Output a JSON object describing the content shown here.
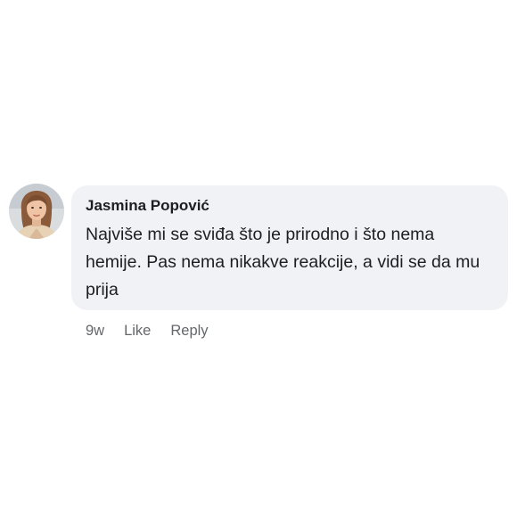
{
  "comment": {
    "author": "Jasmina Popović",
    "text": "Najviše mi se sviđa što je prirodno i što nema hemije. Pas nema nikakve reakcije, a vidi se da mu prija",
    "timestamp": "9w",
    "like_label": "Like",
    "reply_label": "Reply",
    "avatar_icon": "user-avatar-photo"
  },
  "colors": {
    "bubble_background": "#f0f2f5",
    "text": "#1c1e21",
    "secondary_text": "#65676b"
  }
}
